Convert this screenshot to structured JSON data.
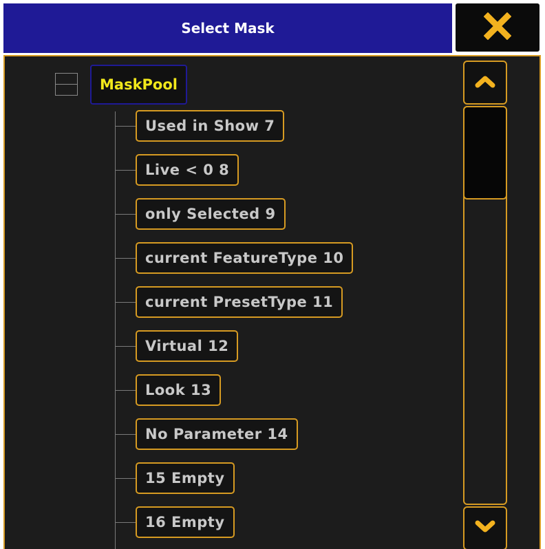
{
  "window": {
    "title": "Select Mask",
    "close_icon": "close-x-icon"
  },
  "tree": {
    "root_label": "MaskPool",
    "root_expanded": true,
    "items": [
      {
        "label": "Used in Show 7"
      },
      {
        "label": "Live < 0 8"
      },
      {
        "label": "only Selected 9"
      },
      {
        "label": "current FeatureType 10"
      },
      {
        "label": "current PresetType 11"
      },
      {
        "label": "Virtual 12"
      },
      {
        "label": "Look 13"
      },
      {
        "label": "No Parameter 14"
      },
      {
        "label": "15 Empty"
      },
      {
        "label": "16 Empty"
      }
    ]
  },
  "scrollbar": {
    "up_icon": "chevron-up-icon",
    "down_icon": "chevron-down-icon"
  },
  "colors": {
    "title_bg": "#1f1a96",
    "accent": "#d79b22",
    "root_text": "#f1e81b",
    "item_text": "#c8c8c8",
    "panel_bg": "#1c1c1c"
  }
}
